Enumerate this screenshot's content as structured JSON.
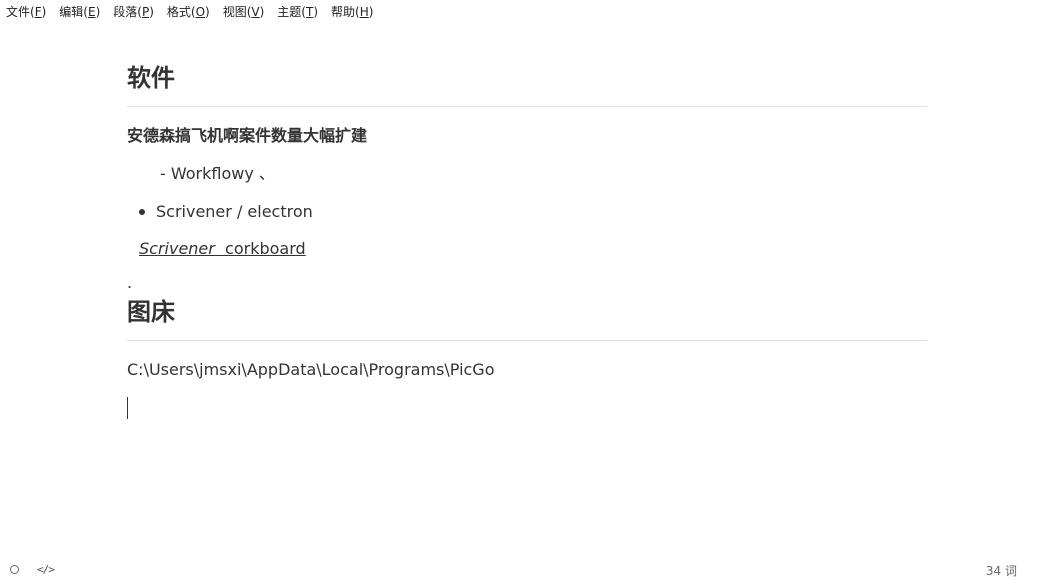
{
  "menubar": {
    "items": [
      {
        "label": "文件(",
        "key": "F",
        "end": ")"
      },
      {
        "label": "编辑(",
        "key": "E",
        "end": ")"
      },
      {
        "label": "段落(",
        "key": "P",
        "end": ")"
      },
      {
        "label": "格式(",
        "key": "O",
        "end": ")"
      },
      {
        "label": "视图(",
        "key": "V",
        "end": ")"
      },
      {
        "label": "主题(",
        "key": "T",
        "end": ")"
      },
      {
        "label": "帮助(",
        "key": "H",
        "end": ")"
      }
    ]
  },
  "document": {
    "heading1": "软件",
    "bold_line": "安德森搞飞机啊案件数量大幅扩建",
    "indent_line": "- Workflowy 、",
    "bullet": "Scrivener / electron",
    "link_italic": "Scrivener",
    "link_rest": "  corkboard",
    "dot": ".",
    "heading2": "图床",
    "path": "C:\\Users\\jmsxi\\AppData\\Local\\Programs\\PicGo"
  },
  "statusbar": {
    "source_toggle_icon": "</>",
    "word_count": "34 词"
  }
}
